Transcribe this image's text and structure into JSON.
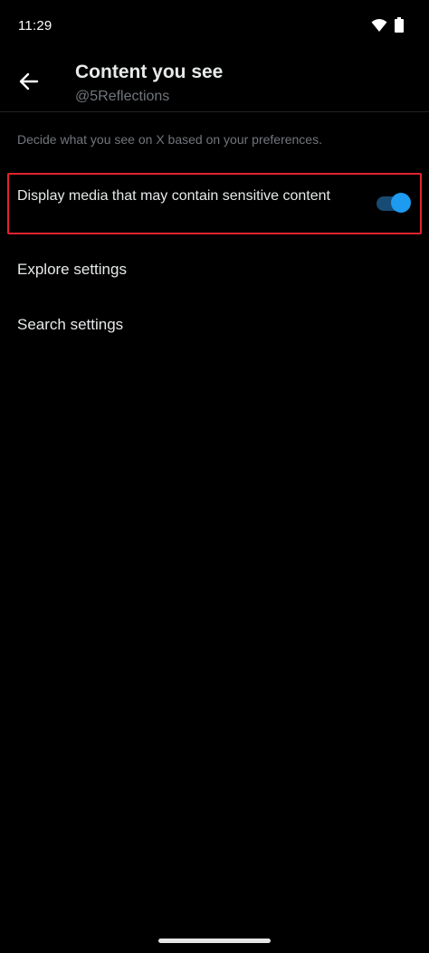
{
  "status_bar": {
    "time": "11:29",
    "icons": [
      "wifi-icon",
      "battery-icon"
    ]
  },
  "header": {
    "title": "Content you see",
    "subtitle": "@5Reflections",
    "back_icon": "arrow-left-icon"
  },
  "description": "Decide what you see on X based on your preferences.",
  "sensitive_media": {
    "label": "Display media that may contain sensitive content",
    "enabled": true,
    "highlight_color": "#e0232e"
  },
  "menu": [
    {
      "label": "Explore settings"
    },
    {
      "label": "Search settings"
    }
  ],
  "colors": {
    "accent": "#1d9bf0",
    "background": "#000000",
    "text_primary": "#e7e9ea",
    "text_secondary": "#71767b"
  }
}
